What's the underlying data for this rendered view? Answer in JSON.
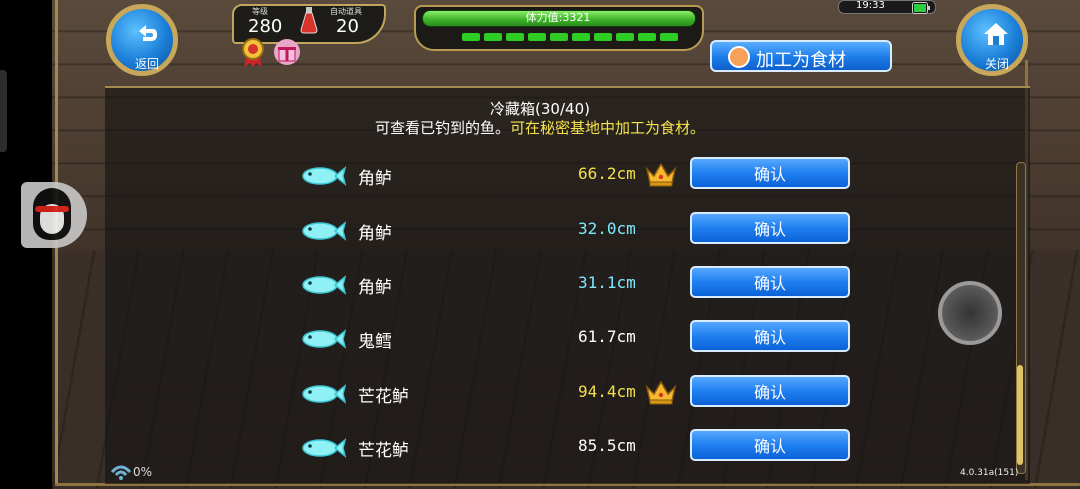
{
  "hud": {
    "level_label": "等级",
    "level_value": "280",
    "auto_label": "自动道具",
    "auto_value": "20",
    "stamina_label": "体力值:3321",
    "clock": "19:33"
  },
  "buttons": {
    "back_label": "返回",
    "close_label": "关闭",
    "process_label": "加工为食材"
  },
  "panel": {
    "title": "冷藏箱(30/40)",
    "subtitle_white": "可查看已钓到的鱼。",
    "subtitle_yellow": "可在秘密基地中加工为食材。"
  },
  "fish_list": [
    {
      "name": "角鲈",
      "length": "66.2cm",
      "crown": true,
      "length_color": "#f3e04a",
      "confirm": "确认"
    },
    {
      "name": "角鲈",
      "length": "32.0cm",
      "crown": false,
      "length_color": "#7fe8ff",
      "confirm": "确认"
    },
    {
      "name": "角鲈",
      "length": "31.1cm",
      "crown": false,
      "length_color": "#7fe8ff",
      "confirm": "确认"
    },
    {
      "name": "鬼鳕",
      "length": "61.7cm",
      "crown": false,
      "length_color": "#ffffff",
      "confirm": "确认"
    },
    {
      "name": "芒花鲈",
      "length": "94.4cm",
      "crown": true,
      "length_color": "#f3e04a",
      "confirm": "确认"
    },
    {
      "name": "芒花鲈",
      "length": "85.5cm",
      "crown": false,
      "length_color": "#ffffff",
      "confirm": "确认"
    }
  ],
  "footer": {
    "signal_pct": "0%",
    "version": "4.0.31a(151)"
  },
  "colors": {
    "button_blue": "#1f7ff0",
    "gold_frame": "#bfa55e",
    "stamina_green": "#3fb52a",
    "highlight_yellow": "#f5e34a"
  },
  "icons": [
    "back-arrow-icon",
    "home-icon",
    "fish-icon",
    "crown-icon",
    "potion-icon",
    "badge-icon",
    "gift-icon",
    "battery-icon",
    "wifi-icon",
    "qq-penguin-icon"
  ]
}
